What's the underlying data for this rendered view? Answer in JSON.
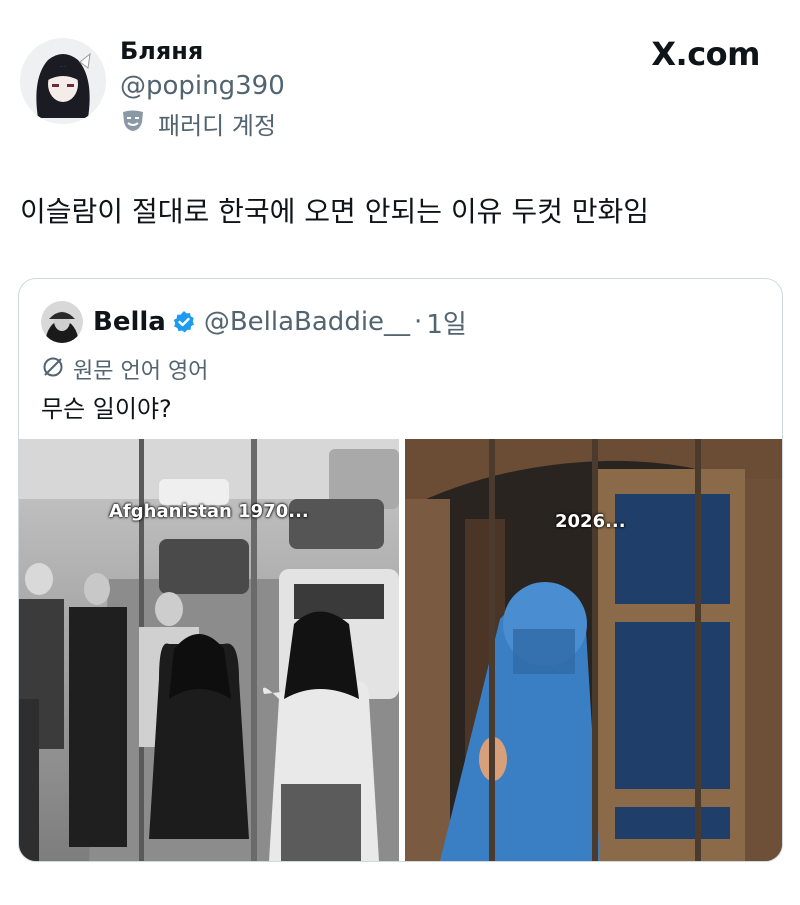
{
  "header": {
    "display_name": "Бляня",
    "handle": "@poping390",
    "parody_label": "패러디 계정",
    "site_logo": "X.com"
  },
  "tweet": {
    "text": "이슬람이 절대로 한국에 오면 안되는 이유 두컷 만화임"
  },
  "quote": {
    "name": "Bella",
    "handle": "@BellaBaddie__",
    "dot": "·",
    "time": "1일",
    "translate_label": "원문 언어 영어",
    "text": "무슨 일이야?",
    "images": [
      {
        "caption": "Afghanistan 1970..."
      },
      {
        "caption": "2026..."
      }
    ]
  },
  "colors": {
    "verified": "#1d9bf0",
    "secondary_text": "#536471",
    "border": "#cfd9de"
  },
  "icons": [
    "parody-mask-icon",
    "verified-badge-icon",
    "translate-icon"
  ]
}
